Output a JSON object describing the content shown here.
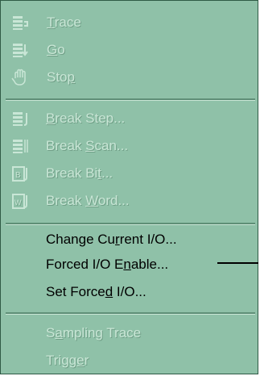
{
  "menu": {
    "group1": [
      {
        "pre": "",
        "u": "T",
        "post": "race",
        "icon": "trace-icon",
        "enabled": false
      },
      {
        "pre": "",
        "u": "G",
        "post": "o",
        "icon": "go-icon",
        "enabled": false
      },
      {
        "pre": "Sto",
        "u": "p",
        "post": "",
        "icon": "hand-stop-icon",
        "enabled": false
      }
    ],
    "group2": [
      {
        "pre": "",
        "u": "B",
        "post": "reak Step...",
        "icon": "break-step-icon",
        "enabled": false
      },
      {
        "pre": "Break ",
        "u": "S",
        "post": "can...",
        "icon": "break-scan-icon",
        "enabled": false
      },
      {
        "pre": "Break Bi",
        "u": "t",
        "post": "...",
        "icon": "break-bit-icon",
        "enabled": false
      },
      {
        "pre": "Break ",
        "u": "W",
        "post": "ord...",
        "icon": "break-word-icon",
        "enabled": false
      }
    ],
    "group3": [
      {
        "pre": "Change Cu",
        "u": "r",
        "post": "rent I/O...",
        "enabled": true
      },
      {
        "pre": "Forced I/O E",
        "u": "n",
        "post": "able...",
        "enabled": true
      },
      {
        "pre": "Set Force",
        "u": "d",
        "post": " I/O...",
        "enabled": true
      }
    ],
    "group4": [
      {
        "pre": "S",
        "u": "a",
        "post": "mpling Trace",
        "enabled": false
      },
      {
        "pre": "Trigg",
        "u": "e",
        "post": "r",
        "enabled": false
      }
    ]
  },
  "colors": {
    "menu_bg": "#8fc1a8",
    "disabled_text": "#c9e6d6",
    "enabled_text": "#000000",
    "separator": "#5f8f77"
  }
}
